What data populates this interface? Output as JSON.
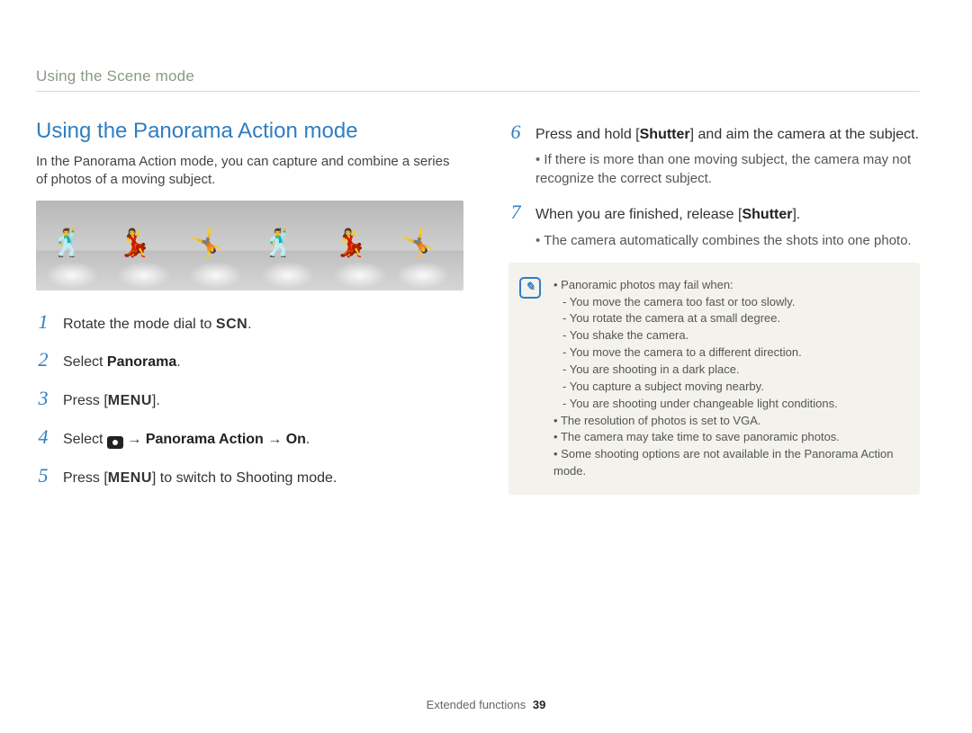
{
  "section_label": "Using the Scene mode",
  "title": "Using the Panorama Action mode",
  "intro": "In the Panorama Action mode, you can capture and combine a series of photos of a moving subject.",
  "glyphs": {
    "scn": "SCN",
    "menu": "MENU"
  },
  "steps_left": [
    {
      "prefix": "Rotate the mode dial to ",
      "glyph": "scn",
      "suffix": "."
    },
    {
      "prefix": "Select ",
      "bold": "Panorama",
      "suffix": "."
    },
    {
      "prefix": "Press [",
      "glyph": "menu",
      "suffix": "]."
    },
    {
      "prefix": "Select ",
      "cam": true,
      "arrow1": " → ",
      "bold": "Panorama Action",
      "arrow2": " → ",
      "bold2": "On",
      "suffix": "."
    },
    {
      "prefix": "Press [",
      "glyph": "menu",
      "suffix": "] to switch to Shooting mode."
    }
  ],
  "steps_right": [
    {
      "n": 6,
      "text_a": "Press and hold [",
      "bold_a": "Shutter",
      "text_b": "] and aim the camera at the subject.",
      "sub": [
        "If there is more than one moving subject, the camera may not recognize the correct subject."
      ]
    },
    {
      "n": 7,
      "text_a": "When you are finished, release [",
      "bold_a": "Shutter",
      "text_b": "].",
      "sub": [
        "The camera automatically combines the shots into one photo."
      ]
    }
  ],
  "note": {
    "fail_intro": "Panoramic photos may fail when:",
    "fail_reasons": [
      "You move the camera too fast or too slowly.",
      "You rotate the camera at a small degree.",
      "You shake the camera.",
      "You move the camera to a different direction.",
      "You are shooting in a dark place.",
      "You capture a subject moving nearby.",
      "You are shooting under changeable light conditions."
    ],
    "extras": [
      "The resolution of photos is set to VGA.",
      "The camera may take time to save panoramic photos.",
      "Some shooting options are not available in the Panorama Action mode."
    ]
  },
  "footer": {
    "label": "Extended functions",
    "page": "39"
  }
}
